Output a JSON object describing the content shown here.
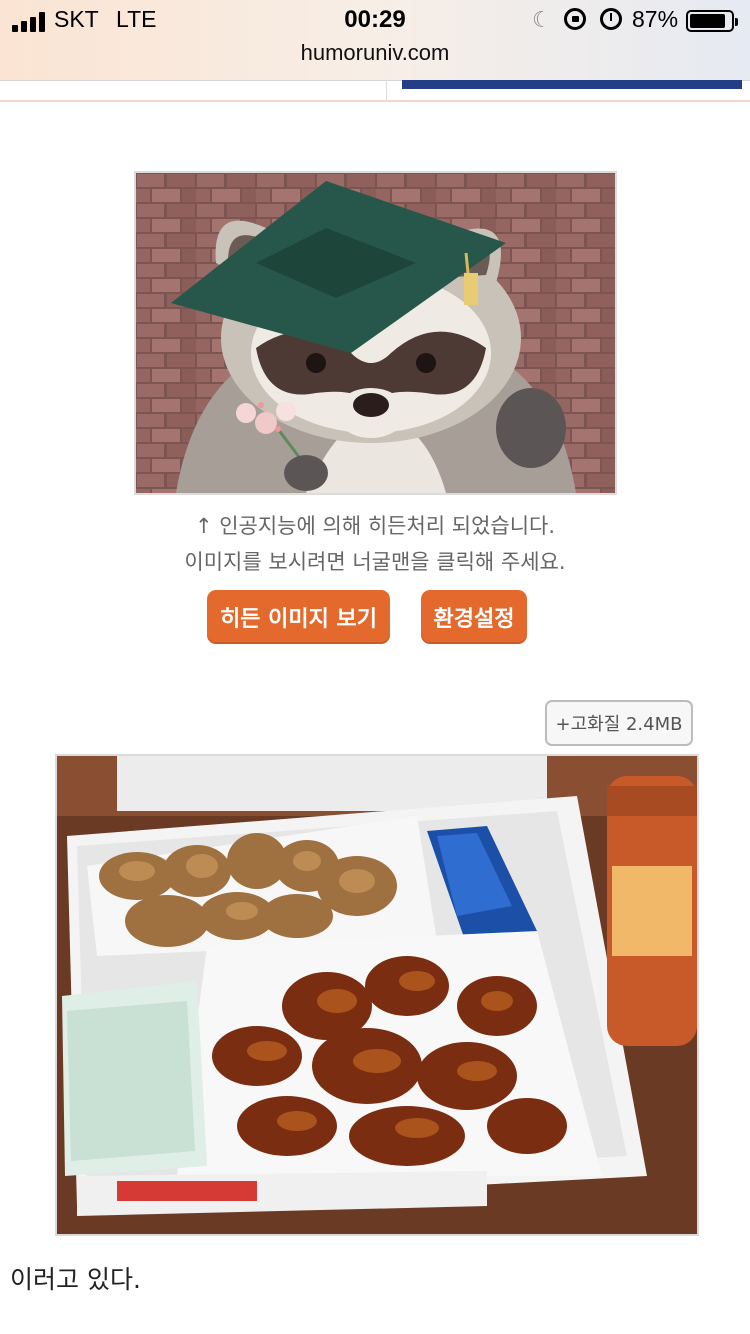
{
  "status_bar": {
    "carrier": "SKT",
    "network": "LTE",
    "time": "00:29",
    "battery_percent": "87%",
    "battery_level": 0.87,
    "url": "humoruniv.com"
  },
  "hidden_image": {
    "notice_line1": "↑ 인공지능에 의해 히든처리 되었습니다.",
    "notice_line2": "이미지를 보시려면 너굴맨을 클릭해 주세요.",
    "show_button": "히든 이미지 보기",
    "settings_button": "환경설정"
  },
  "photo": {
    "hires_button": "+고화질 2.4MB"
  },
  "post": {
    "text": "이러고 있다."
  },
  "colors": {
    "accent_button": "#e36a2c",
    "nav_blue": "#233d87"
  }
}
